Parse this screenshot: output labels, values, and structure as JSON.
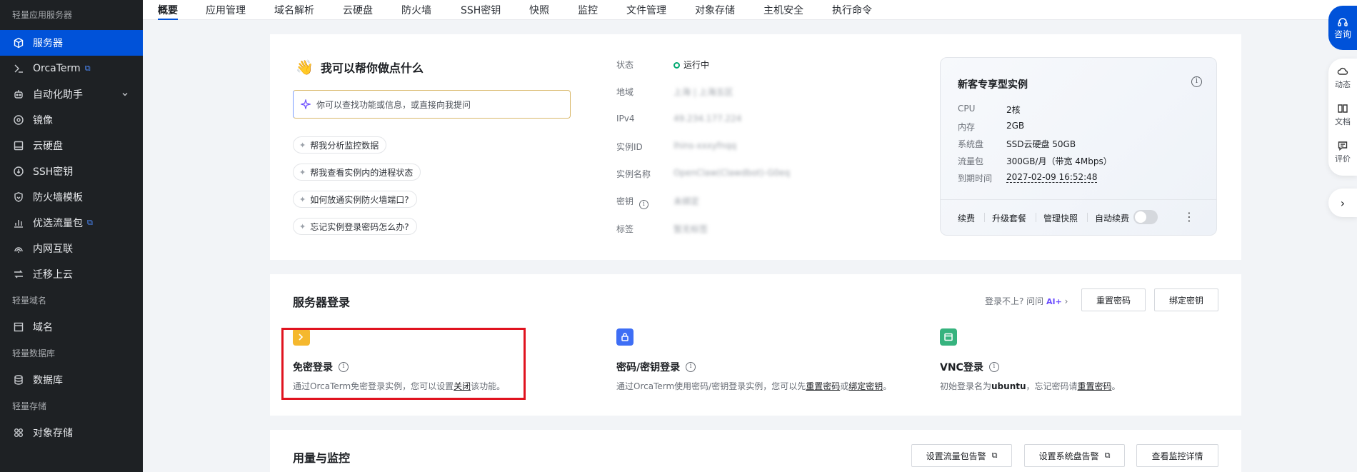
{
  "sidebar": {
    "groups": [
      {
        "title": "轻量应用服务器"
      },
      {
        "title": "轻量域名"
      },
      {
        "title": "轻量数据库"
      },
      {
        "title": "轻量存储"
      }
    ],
    "items": [
      {
        "label": "服务器",
        "icon": "cube-icon"
      },
      {
        "label": "OrcaTerm",
        "icon": "terminal-icon"
      },
      {
        "label": "自动化助手",
        "icon": "robot-icon"
      },
      {
        "label": "镜像",
        "icon": "image-disc-icon"
      },
      {
        "label": "云硬盘",
        "icon": "disk-icon"
      },
      {
        "label": "SSH密钥",
        "icon": "key-icon"
      },
      {
        "label": "防火墙模板",
        "icon": "shield-icon"
      },
      {
        "label": "优选流量包",
        "icon": "traffic-chart-icon"
      },
      {
        "label": "内网互联",
        "icon": "network-icon"
      },
      {
        "label": "迁移上云",
        "icon": "migrate-icon"
      },
      {
        "label": "域名",
        "icon": "domain-icon"
      },
      {
        "label": "数据库",
        "icon": "database-icon"
      },
      {
        "label": "对象存储",
        "icon": "storage-icon"
      }
    ]
  },
  "tabs": [
    "概要",
    "应用管理",
    "域名解析",
    "云硬盘",
    "防火墙",
    "SSH密钥",
    "快照",
    "监控",
    "文件管理",
    "对象存储",
    "主机安全",
    "执行命令"
  ],
  "ai": {
    "title": "我可以帮你做点什么",
    "placeholder": "你可以查找功能或信息，或直接向我提问",
    "suggestions": [
      "帮我分析监控数据",
      "帮我查看实例内的进程状态",
      "如何放通实例防火墙端口?",
      "忘记实例登录密码怎么办?"
    ]
  },
  "info": {
    "status_label": "状态",
    "status_value": "运行中",
    "region_label": "地域",
    "region_value": "上海 | 上海五区",
    "ipv4_label": "IPv4",
    "ipv4_value": "49.234.177.224",
    "id_label": "实例ID",
    "id_value": "lhins-xxxyfnqq",
    "name_label": "实例名称",
    "name_value": "OpenClaw(Clawdbot)-G0eq",
    "key_label": "密钥",
    "key_value": "未绑定",
    "tag_label": "标签",
    "tag_value": "暂无标签"
  },
  "instance": {
    "title": "新客专享型实例",
    "rows": [
      {
        "k": "CPU",
        "v": "2核"
      },
      {
        "k": "内存",
        "v": "2GB"
      },
      {
        "k": "系统盘",
        "v": "SSD云硬盘 50GB"
      },
      {
        "k": "流量包",
        "v": "300GB/月（带宽 4Mbps）"
      },
      {
        "k": "到期时间",
        "v": "2027-02-09 16:52:48"
      }
    ],
    "actions": [
      "续费",
      "升级套餐",
      "管理快照",
      "自动续费"
    ],
    "auto_renew": false
  },
  "login": {
    "title": "服务器登录",
    "help_text": "登录不上? 问问",
    "help_ai": "AI+",
    "reset_pwd": "重置密码",
    "bind_key": "绑定密钥",
    "modes": [
      {
        "title": "免密登录",
        "desc_a": "通过OrcaTerm免密登录实例，您可以设置",
        "link_a": "关闭",
        "desc_b": "该功能。",
        "color": "#f5b82e"
      },
      {
        "title": "密码/密钥登录",
        "desc_a": "通过OrcaTerm使用密码/密钥登录实例，您可以先",
        "link_a": "重置密码",
        "desc_b": "或",
        "link_b": "绑定密钥",
        "desc_c": "。",
        "color": "#3e6ef5"
      },
      {
        "title": "VNC登录",
        "desc_a": "初始登录名为",
        "bold": "ubuntu",
        "desc_b": "，忘记密码请",
        "link_a": "重置密码",
        "desc_c": "。",
        "color": "#36b37e"
      }
    ]
  },
  "usage": {
    "title": "用量与监控",
    "btn_traffic_alert": "设置流量包告警",
    "btn_disk_alert": "设置系统盘告警",
    "btn_monitor": "查看监控详情"
  },
  "float": {
    "consult": "咨询",
    "items": [
      "动态",
      "文档",
      "评价"
    ]
  },
  "colors": {
    "accent": "#0052d9",
    "running": "#00a870",
    "highlight": "#e0131f"
  }
}
